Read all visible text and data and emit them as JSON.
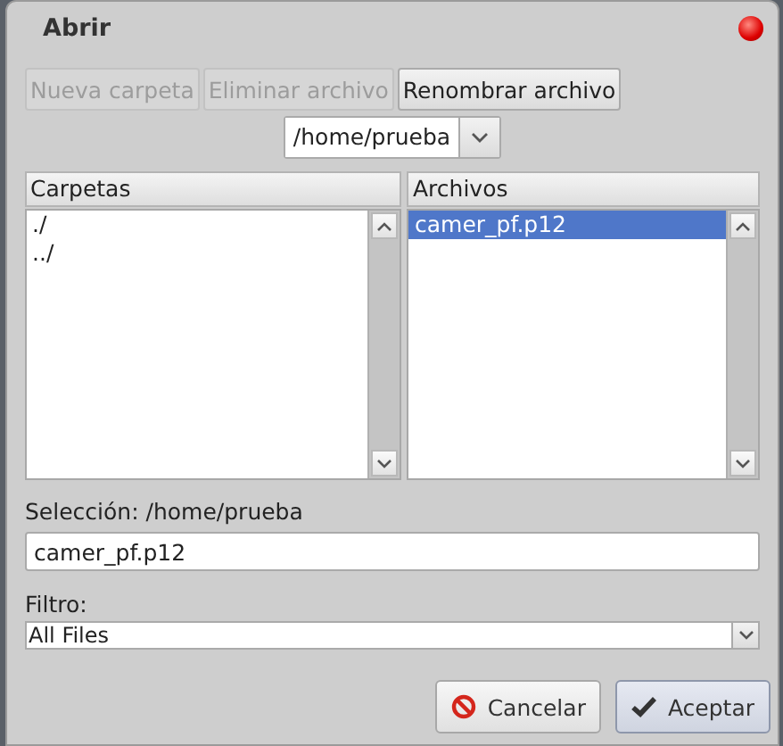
{
  "window": {
    "title": "Abrir"
  },
  "toolbar": [
    {
      "label": "Nueva carpeta",
      "disabled": true
    },
    {
      "label": "Eliminar archivo",
      "disabled": true
    },
    {
      "label": "Renombrar archivo",
      "disabled": false
    }
  ],
  "path": {
    "value": "/home/prueba"
  },
  "folders": {
    "header": "Carpetas",
    "items": [
      {
        "label": "./",
        "selected": false
      },
      {
        "label": "../",
        "selected": false
      }
    ]
  },
  "files": {
    "header": "Archivos",
    "items": [
      {
        "label": "camer_pf.p12",
        "selected": true
      }
    ]
  },
  "selection": {
    "label": "Selección: /home/prueba",
    "value": "camer_pf.p12"
  },
  "filter": {
    "label": "Filtro:",
    "value": "All Files"
  },
  "buttons": [
    {
      "label": "Cancelar",
      "kind": "cancel"
    },
    {
      "label": "Aceptar",
      "kind": "ok"
    }
  ]
}
